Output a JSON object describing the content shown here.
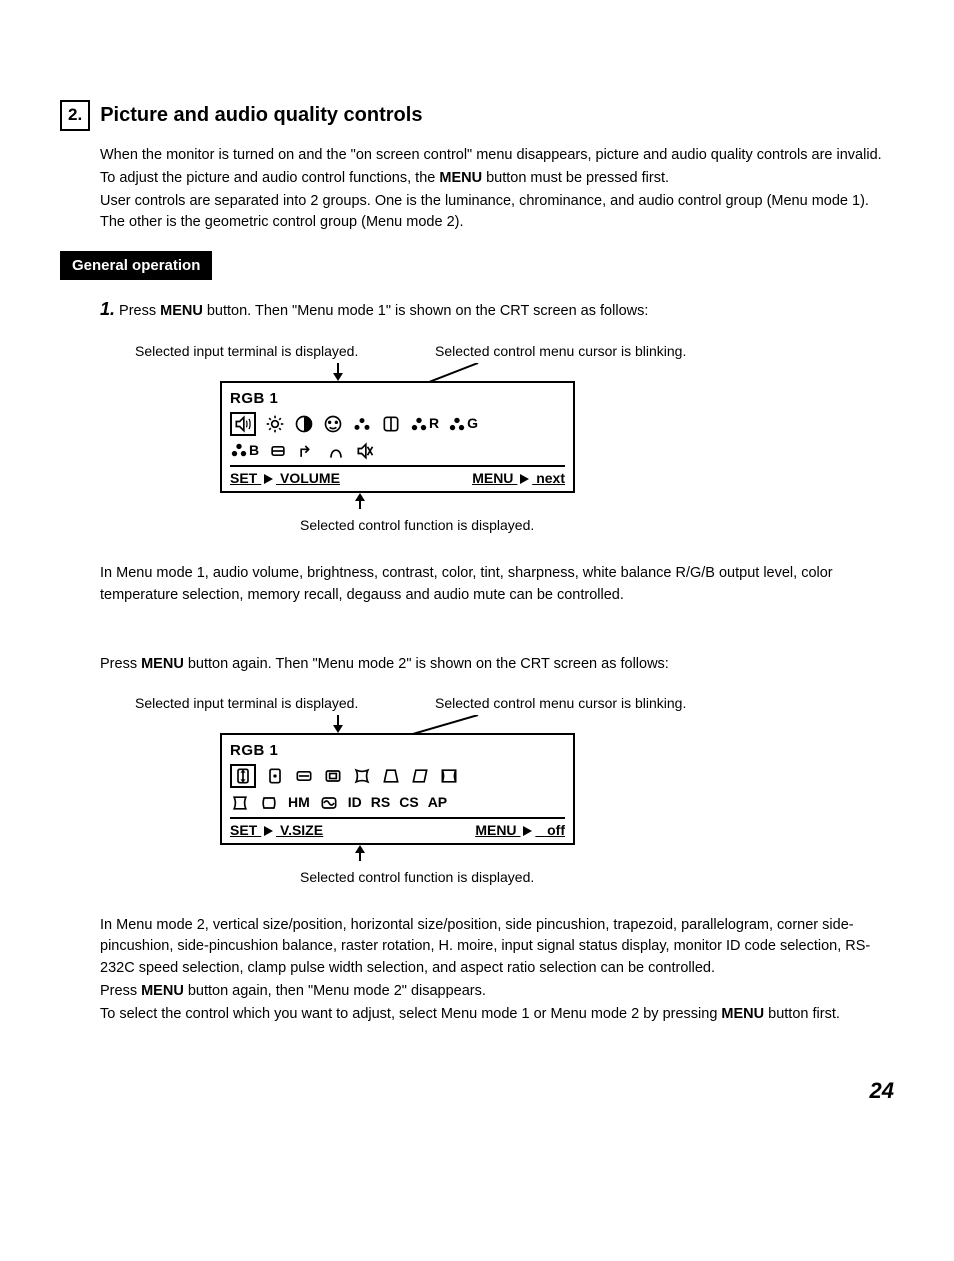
{
  "section": {
    "num": "2.",
    "title": "Picture and audio quality controls"
  },
  "intro": {
    "p1": "When the monitor is turned on and the \"on screen control\" menu disappears, picture and audio quality controls are invalid.",
    "p2_a": "To adjust the picture and audio control functions, the ",
    "p2_b": "MENU",
    "p2_c": " button must be pressed first.",
    "p3": "User controls are separated into 2 groups. One is the luminance, chrominance, and audio control group (Menu mode 1). The other is the geometric control group (Menu mode 2)."
  },
  "subheader": "General operation",
  "step1": {
    "num": "1.",
    "a": " Press ",
    "b": "MENU",
    "c": " button. Then \"Menu mode 1\" is shown on the CRT screen as follows:"
  },
  "callout_left": "Selected input terminal is displayed.",
  "callout_right": "Selected control menu cursor is blinking.",
  "callout_bottom": "Selected control function is displayed.",
  "osd1": {
    "label": "RGB 1",
    "r": "R",
    "g": "G",
    "b": "B",
    "set": "SET",
    "vol": "VOLUME",
    "menu": "MENU",
    "next": "next"
  },
  "para1": "In Menu mode 1, audio volume, brightness, contrast, color, tint, sharpness, white balance R/G/B output level, color temperature selection, memory recall, degauss and audio mute can be controlled.",
  "step2": {
    "a": "Press ",
    "b": "MENU",
    "c": " button again. Then \"Menu mode 2\" is shown on the CRT screen as follows:"
  },
  "osd2": {
    "label": "RGB 1",
    "hm": "HM",
    "id": "ID",
    "rs": "RS",
    "cs": "CS",
    "ap": "AP",
    "set": "SET",
    "vsize": "V.SIZE",
    "menu": "MENU",
    "off": "off"
  },
  "para2": {
    "p1": "In Menu mode 2, vertical size/position, horizontal size/position, side pincushion, trapezoid, parallelogram, corner side-pincushion, side-pincushion balance, raster rotation, H. moire, input signal status display, monitor ID code selection, RS-232C speed selection, clamp pulse width selection, and aspect ratio selection can be controlled.",
    "p2a": "Press ",
    "p2b": "MENU",
    "p2c": " button again, then \"Menu mode 2\" disappears.",
    "p3a": "To select the control which you want to adjust, select Menu mode 1 or Menu mode 2 by pressing ",
    "p3b": "MENU",
    "p3c": " button first."
  },
  "page": "24"
}
